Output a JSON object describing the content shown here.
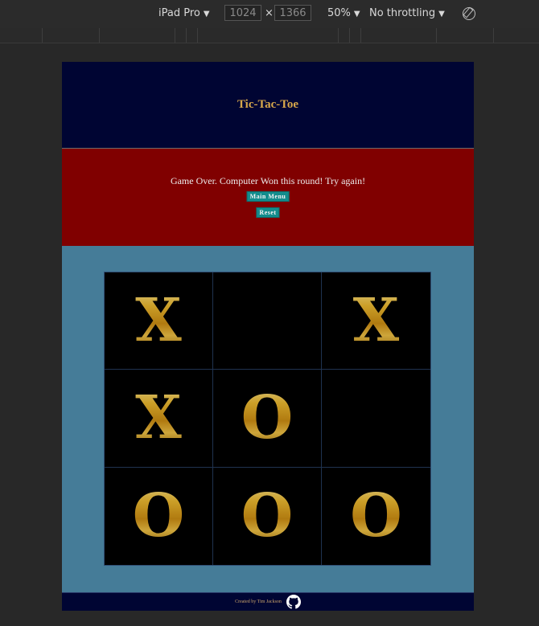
{
  "devtools": {
    "device": "iPad Pro",
    "width": "1024",
    "times": "×",
    "height": "1366",
    "zoom": "50%",
    "throttling": "No throttling",
    "rotate_icon": "rotate-icon"
  },
  "header": {
    "title": "Tic-Tac-Toe"
  },
  "status": {
    "message": "Game Over. Computer Won this round! Try again!",
    "main_menu_label": "Main Menu",
    "reset_label": "Reset"
  },
  "board": {
    "cells": [
      "X",
      "",
      "X",
      "X",
      "O",
      "",
      "O",
      "O",
      "O"
    ]
  },
  "footer": {
    "credit": "Created by Tim Jackson",
    "icon": "github-icon"
  },
  "colors": {
    "header_bg": "#000533",
    "status_bg": "#800000",
    "board_area_bg": "#457c98",
    "button_bg": "#138c8c",
    "title_color": "#d7a74b",
    "mark_gold": "#e8b32a"
  }
}
